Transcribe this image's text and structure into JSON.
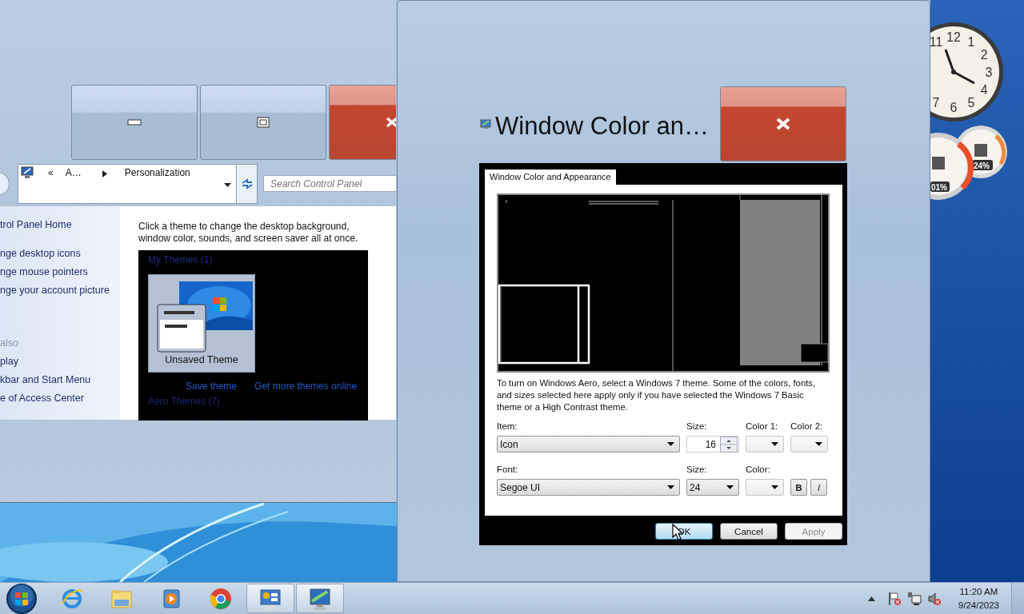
{
  "explorer_window": {
    "caption_buttons": [
      {
        "kind": "minimize"
      },
      {
        "kind": "maximize"
      },
      {
        "kind": "close"
      }
    ],
    "address_bar": {
      "crumbs": [
        "«",
        "A…",
        "Personalization"
      ]
    },
    "search": {
      "placeholder": "Search Control Panel"
    },
    "sidebar": {
      "links": [
        "trol Panel Home",
        "nge desktop icons",
        "nge mouse pointers",
        "nge your account picture"
      ],
      "see_also_heading": "also",
      "see_also": [
        "play",
        "kbar and Start Menu",
        "e of Access Center"
      ]
    },
    "content": {
      "description": "Click a theme to change the desktop background, window color, sounds, and screen saver all at once.",
      "themes_panel": {
        "my_themes_heading": "My Themes (1)",
        "themes": [
          {
            "name": "Unsaved Theme",
            "selected": true
          }
        ],
        "links": [
          "Save theme",
          "Get more themes online"
        ],
        "aero_heading": "Aero Themes (7)"
      }
    }
  },
  "dialog": {
    "title": "Window Color an…",
    "tabs": [
      {
        "label": "Window Color and Appearance",
        "selected": true
      }
    ],
    "note": "To turn on Windows Aero, select a Windows 7 theme.  Some of the colors, fonts, and sizes selected here apply only if you have selected the Windows 7 Basic theme or a High Contrast theme.",
    "item": {
      "label": "Item:",
      "value": "Icon"
    },
    "item_size": {
      "label": "Size:",
      "value": "16"
    },
    "color_1": {
      "label": "Color 1:"
    },
    "color_2": {
      "label": "Color 2:"
    },
    "font": {
      "label": "Font:",
      "value": "Segoe UI"
    },
    "font_size": {
      "label": "Size:",
      "value": "24"
    },
    "font_color": {
      "label": "Color:"
    },
    "style_buttons": [
      {
        "label": "B",
        "kind": "bold"
      },
      {
        "label": "I",
        "kind": "italic"
      }
    ],
    "buttons": [
      {
        "label": "OK",
        "focused": true,
        "disabled": false
      },
      {
        "label": "Cancel",
        "focused": false,
        "disabled": false
      },
      {
        "label": "Apply",
        "focused": false,
        "disabled": true
      }
    ]
  },
  "gadgets": {
    "clock": {
      "numerals": [
        "12",
        "1",
        "2",
        "3",
        "4",
        "5",
        "6",
        "7",
        "11"
      ]
    },
    "cpu_meter": {
      "readings": [
        "01%",
        "24%"
      ]
    }
  },
  "taskbar": {
    "apps": [
      {
        "kind": "browser-e",
        "active": false
      },
      {
        "kind": "folder",
        "active": false
      },
      {
        "kind": "media",
        "active": false
      },
      {
        "kind": "chrome",
        "active": false
      },
      {
        "kind": "control-panel",
        "active": true
      },
      {
        "kind": "display",
        "active": true
      }
    ],
    "tray": {
      "time": "11:20 AM",
      "date": "9/24/2023"
    }
  }
}
